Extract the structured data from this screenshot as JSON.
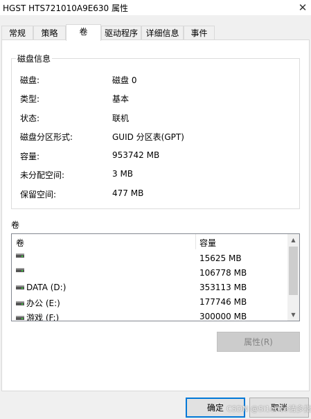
{
  "window": {
    "title": "HGST HTS721010A9E630 属性"
  },
  "tabs": [
    {
      "label": "常规"
    },
    {
      "label": "策略"
    },
    {
      "label": "卷"
    },
    {
      "label": "驱动程序"
    },
    {
      "label": "详细信息"
    },
    {
      "label": "事件"
    }
  ],
  "disk_info": {
    "title": "磁盘信息",
    "rows": [
      {
        "label": "磁盘:",
        "value": "磁盘 0"
      },
      {
        "label": "类型:",
        "value": "基本"
      },
      {
        "label": "状态:",
        "value": "联机"
      },
      {
        "label": "磁盘分区形式:",
        "value": "GUID 分区表(GPT)"
      },
      {
        "label": "容量:",
        "value": "953742 MB"
      },
      {
        "label": "未分配空间:",
        "value": "3 MB"
      },
      {
        "label": "保留空间:",
        "value": "477 MB"
      }
    ]
  },
  "volumes": {
    "label": "卷",
    "columns": {
      "name": "卷",
      "capacity": "容量"
    },
    "rows": [
      {
        "name": "",
        "capacity": "15625 MB"
      },
      {
        "name": "",
        "capacity": "106778 MB"
      },
      {
        "name": "DATA (D:)",
        "capacity": "353113 MB"
      },
      {
        "name": "办公 (E:)",
        "capacity": "177746 MB"
      },
      {
        "name": "游戏 (F:)",
        "capacity": "300000 MB"
      }
    ]
  },
  "buttons": {
    "properties": "属性(R)",
    "ok": "确定",
    "cancel": "取消"
  },
  "watermark": "CSDN @Si1ence请多指教",
  "icons": {
    "close": "close-icon",
    "drive": "drive-icon",
    "scroll_up": "chevron-up-icon",
    "scroll_down": "chevron-down-icon"
  },
  "colors": {
    "accent": "#0078d7",
    "panel": "#ffffff",
    "background": "#f0f0f0"
  }
}
